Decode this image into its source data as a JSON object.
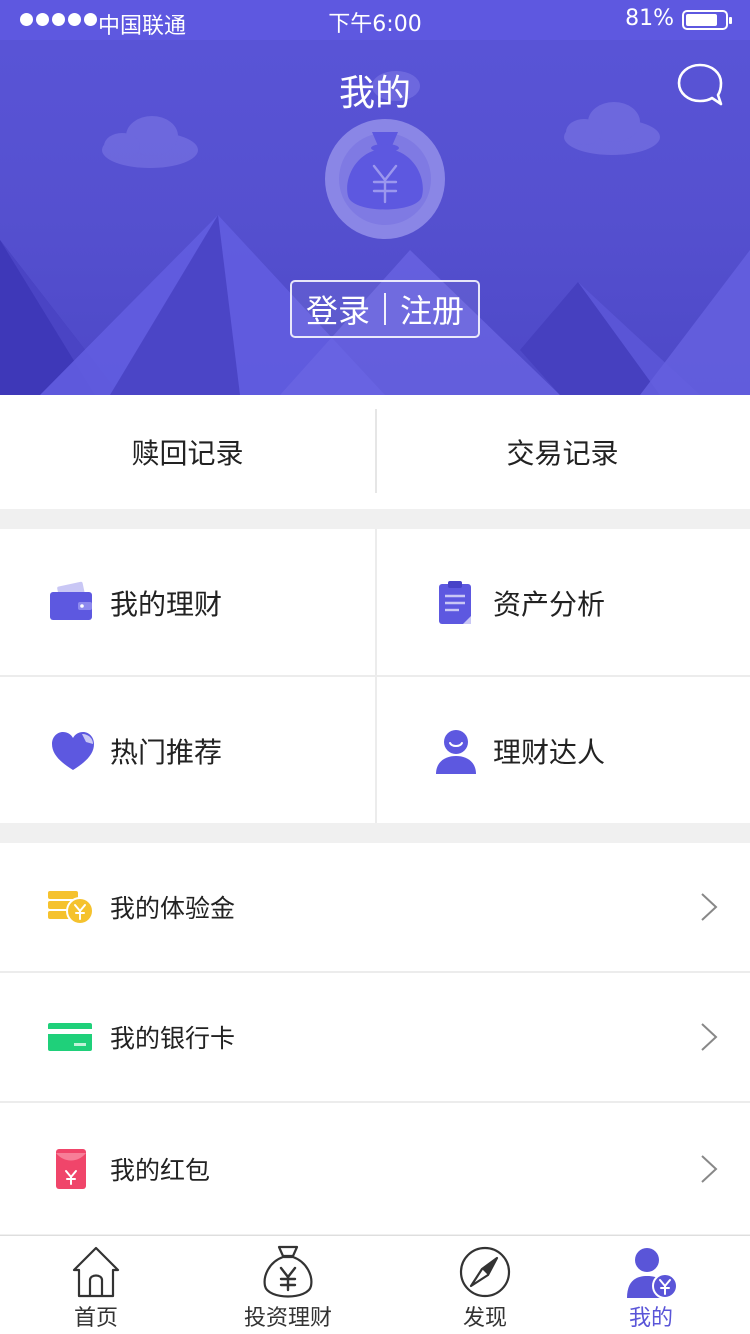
{
  "status_bar": {
    "carrier": "中国联通",
    "time": "下午6:00",
    "battery": "81%",
    "battery_level": 0.81
  },
  "header": {
    "title": "我的",
    "message_icon": "chat-bubble-icon",
    "avatar_icon": "money-bag-icon",
    "login_label": "登录",
    "register_label": "注册"
  },
  "records": [
    {
      "label": "赎回记录"
    },
    {
      "label": "交易记录"
    }
  ],
  "grid": [
    {
      "label": "我的理财",
      "icon": "wallet-icon"
    },
    {
      "label": "资产分析",
      "icon": "clipboard-icon"
    },
    {
      "label": "热门推荐",
      "icon": "heart-icon"
    },
    {
      "label": "理财达人",
      "icon": "user-icon"
    }
  ],
  "list": [
    {
      "label": "我的体验金",
      "icon": "coins-icon"
    },
    {
      "label": "我的银行卡",
      "icon": "bank-card-icon"
    },
    {
      "label": "我的红包",
      "icon": "red-envelope-icon"
    }
  ],
  "tabbar": [
    {
      "label": "首页",
      "icon": "home-icon"
    },
    {
      "label": "投资理财",
      "icon": "money-bag-icon"
    },
    {
      "label": "发现",
      "icon": "compass-icon"
    },
    {
      "label": "我的",
      "icon": "profile-icon",
      "active": true
    }
  ],
  "colors": {
    "accent": "#5a55d8",
    "icon_purple": "#5d58e0",
    "coin_yellow": "#f5c22e",
    "card_green": "#1fd07a",
    "envelope_red": "#f0456a"
  }
}
